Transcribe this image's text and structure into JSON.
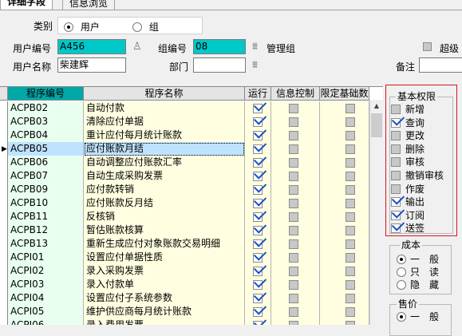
{
  "tabs": [
    {
      "label": "详细字段",
      "active": true
    },
    {
      "label": "信息浏览",
      "active": false
    }
  ],
  "form": {
    "category_label": "类别",
    "radio_user": "用户",
    "radio_group": "组",
    "user_id_label": "用户编号",
    "user_id_value": "A456",
    "group_id_label": "组编号",
    "group_id_value": "08",
    "group_name": "管理组",
    "super_label": "超级",
    "user_name_label": "用户名称",
    "user_name_value": "柴建辉",
    "dept_label": "部门",
    "dept_value": "",
    "note_label": "备注",
    "note_value": ""
  },
  "grid": {
    "headers": [
      "程序编号",
      "程序名称",
      "运行",
      "信息控制",
      "限定基础数"
    ],
    "rows": [
      {
        "code": "ACPB02",
        "name": "自动付款",
        "run": true
      },
      {
        "code": "ACPB03",
        "name": "清除应付单据",
        "run": true
      },
      {
        "code": "ACPB04",
        "name": "重计应付每月统计账款",
        "run": true
      },
      {
        "code": "ACPB05",
        "name": "应付账款月结",
        "run": true,
        "selected": true
      },
      {
        "code": "ACPB06",
        "name": "自动调整应付账款汇率",
        "run": true
      },
      {
        "code": "ACPB07",
        "name": "自动生成采购发票",
        "run": true
      },
      {
        "code": "ACPB09",
        "name": "应付款转销",
        "run": true
      },
      {
        "code": "ACPB10",
        "name": "应付账款反月结",
        "run": true
      },
      {
        "code": "ACPB11",
        "name": "反核销",
        "run": true
      },
      {
        "code": "ACPB12",
        "name": "暂估账款核算",
        "run": true
      },
      {
        "code": "ACPB13",
        "name": "重新生成应付对象账款交易明细",
        "run": true
      },
      {
        "code": "ACPI01",
        "name": "设置应付单据性质",
        "run": true
      },
      {
        "code": "ACPI02",
        "name": "录入采购发票",
        "run": true
      },
      {
        "code": "ACPI03",
        "name": "录入付款单",
        "run": true
      },
      {
        "code": "ACPI04",
        "name": "设置应付子系统参数",
        "run": true
      },
      {
        "code": "ACPI05",
        "name": "维护供应商每月统计账款",
        "run": true
      },
      {
        "code": "ACPI06",
        "name": "录入费用发票",
        "run": true
      }
    ]
  },
  "perms": {
    "title": "基本权限",
    "items": [
      {
        "label": "新增",
        "checked": false
      },
      {
        "label": "查询",
        "checked": true
      },
      {
        "label": "更改",
        "checked": false
      },
      {
        "label": "删除",
        "checked": false
      },
      {
        "label": "审核",
        "checked": false
      },
      {
        "label": "撤销审核",
        "checked": false
      },
      {
        "label": "作废",
        "checked": false
      },
      {
        "label": "输出",
        "checked": true
      },
      {
        "label": "订阅",
        "checked": true
      },
      {
        "label": "送签",
        "checked": true
      }
    ]
  },
  "cost": {
    "title": "成本",
    "options": [
      "一　般",
      "只　读",
      "隐　藏"
    ],
    "selected": 0
  },
  "price": {
    "title": "售价",
    "options": [
      "一　般"
    ],
    "selected": 0
  }
}
